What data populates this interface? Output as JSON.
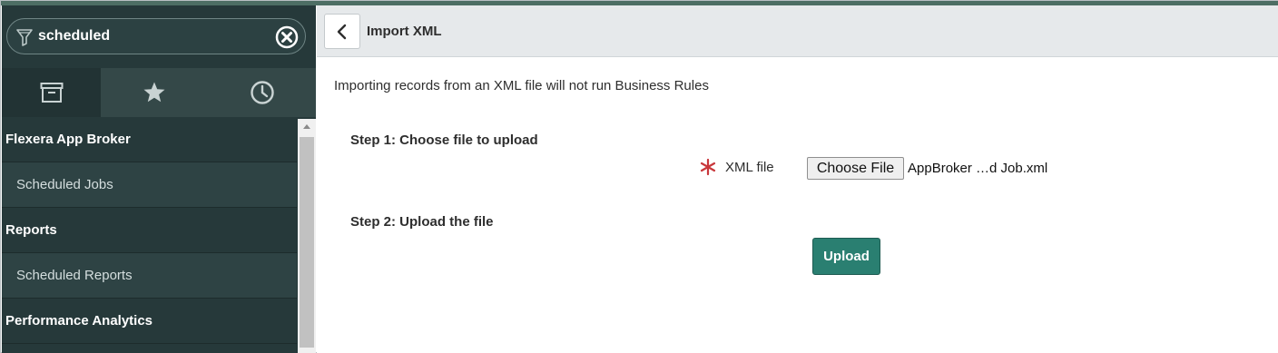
{
  "colors": {
    "sidebar_bg": "#26393a",
    "top_accent": "#4d6e64",
    "upload_button": "#2a7f71",
    "required_marker": "#c8373b"
  },
  "sidebar": {
    "filter": {
      "value": "scheduled",
      "icon": "filter-icon",
      "clear_icon": "clear-circle-x-icon"
    },
    "tabs": [
      {
        "name": "all-applications",
        "icon": "archive-box-icon",
        "active": true
      },
      {
        "name": "favorites",
        "icon": "star-icon",
        "active": false
      },
      {
        "name": "history",
        "icon": "clock-icon",
        "active": false
      }
    ],
    "nav": [
      {
        "type": "section",
        "label": "Flexera App Broker"
      },
      {
        "type": "module",
        "label": "Scheduled Jobs"
      },
      {
        "type": "section",
        "label": "Reports"
      },
      {
        "type": "module",
        "label": "Scheduled Reports"
      },
      {
        "type": "section",
        "label": "Performance Analytics"
      }
    ]
  },
  "header": {
    "back_icon": "chevron-left-icon",
    "title": "Import XML"
  },
  "form": {
    "info": "Importing records from an XML file will not run Business Rules",
    "step1_label": "Step 1: Choose file to upload",
    "xml_file_label": "XML file",
    "choose_file_label": "Choose File",
    "file_name": "AppBroker …d Job.xml",
    "step2_label": "Step 2: Upload the file",
    "upload_label": "Upload"
  }
}
